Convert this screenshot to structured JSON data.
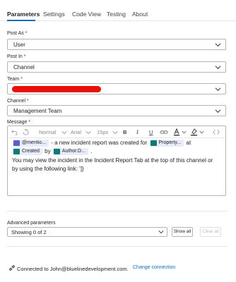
{
  "tabs": [
    {
      "label": "Parameters"
    },
    {
      "label": "Settings"
    },
    {
      "label": "Code View"
    },
    {
      "label": "Testing"
    },
    {
      "label": "About"
    }
  ],
  "fields": {
    "post_as": {
      "label": "Post As",
      "required": "*",
      "value": "User"
    },
    "post_in": {
      "label": "Post In",
      "required": "*",
      "value": "Channel"
    },
    "team": {
      "label": "Team",
      "required": "*",
      "value": ""
    },
    "channel": {
      "label": "Channel",
      "required": "*",
      "value": "Management Team"
    },
    "message": {
      "label": "Message",
      "required": "*"
    }
  },
  "toolbar": {
    "style": "Normal",
    "font": "Arial",
    "size": "15px",
    "bold": "B",
    "italic": "I",
    "underline": "U"
  },
  "message": {
    "token_mention": "@mentio...",
    "text1": "- a new incident report was created for",
    "token_property": "Property...",
    "text_at": "at",
    "token_created": "Created",
    "text_by": "by",
    "token_author": "Author.D...",
    "text_period": ".",
    "line3": "You may view the incident in the Incident Report Tab at the top of this channel or",
    "line4": "by using the following link: ']}"
  },
  "advanced": {
    "title": "Advanced parameters",
    "selected": "Showing 0 of 2",
    "show_all": "Show all",
    "clear_all": "Clear all"
  },
  "connection": {
    "text": "Connected to John@bluelinedevelopment.com.",
    "change": "Change connection"
  },
  "colors": {
    "accent": "#0f6cbd",
    "required": "#c50f1f",
    "redaction": "#e8100a"
  }
}
